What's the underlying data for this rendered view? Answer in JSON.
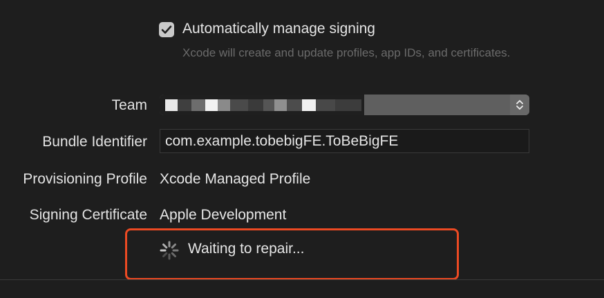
{
  "signing": {
    "auto_manage_label": "Automatically manage signing",
    "auto_manage_checked": true,
    "auto_manage_description": "Xcode will create and update profiles, app IDs, and certificates."
  },
  "team": {
    "label": "Team",
    "value_redacted": true,
    "icon": "chevron-updown-icon"
  },
  "bundle_identifier": {
    "label": "Bundle Identifier",
    "value": "com.example.tobebigFE.ToBeBigFE"
  },
  "provisioning_profile": {
    "label": "Provisioning Profile",
    "value": "Xcode Managed Profile"
  },
  "signing_certificate": {
    "label": "Signing Certificate",
    "value": "Apple Development"
  },
  "status": {
    "text": "Waiting to repair...",
    "icon": "spinner-icon",
    "highlight_color": "#ec4a23"
  }
}
